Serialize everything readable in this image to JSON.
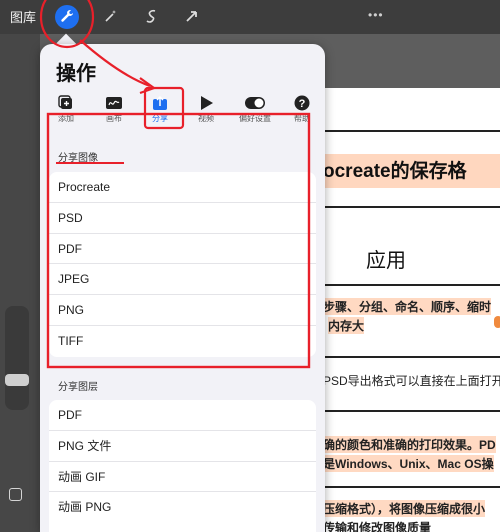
{
  "toolbar": {
    "gallery_label": "图库",
    "tools": [
      {
        "name": "wrench-icon",
        "active": true
      },
      {
        "name": "magic-wand-icon",
        "active": false
      },
      {
        "name": "selection-icon",
        "active": false
      },
      {
        "name": "transform-arrow-icon",
        "active": false
      }
    ],
    "more_dots": "•••"
  },
  "panel": {
    "title": "操作",
    "tabs": [
      {
        "label": "添加",
        "icon": "add-image-icon"
      },
      {
        "label": "画布",
        "icon": "canvas-icon"
      },
      {
        "label": "分享",
        "icon": "share-icon",
        "active": true
      },
      {
        "label": "视频",
        "icon": "play-icon"
      },
      {
        "label": "偏好设置",
        "icon": "toggle-icon"
      },
      {
        "label": "帮助",
        "icon": "help-icon"
      }
    ],
    "share_image_label": "分享图像",
    "share_image_items": [
      "Procreate",
      "PSD",
      "PDF",
      "JPEG",
      "PNG",
      "TIFF"
    ],
    "share_layers_label": "分享图层",
    "share_layers_items": [
      "PDF",
      "PNG 文件",
      "动画 GIF",
      "动画 PNG"
    ]
  },
  "document": {
    "title": "ocreate的保存格",
    "heading": "应用",
    "lines": [
      {
        "text": "步骤、分组、命名、顺序、缩时",
        "highlight": true
      },
      {
        "text": "内存大",
        "highlight": true
      },
      {
        "text": "PSD导出格式可以直接在上面打开",
        "highlight": false
      },
      {
        "text": "确的颜色和准确的打印效果。PD",
        "highlight": true
      },
      {
        "text": "是Windows、Unix、Mac OS操",
        "highlight": true
      },
      {
        "text": "压缩格式），将图像压缩成很小",
        "highlight": true
      },
      {
        "text": "传输和修改图像质量",
        "highlight": false
      }
    ]
  },
  "colors": {
    "accent": "#1e6ff0",
    "annotation": "#e8202a",
    "highlight": "#ffd9c2"
  }
}
